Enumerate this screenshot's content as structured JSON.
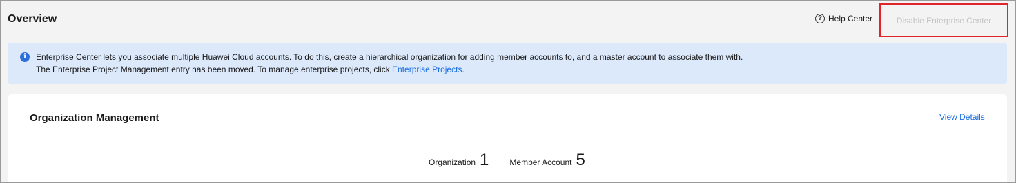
{
  "header": {
    "title": "Overview",
    "help_center": "Help Center",
    "help_icon": "question-circle-icon",
    "disable_button": "Disable Enterprise Center"
  },
  "banner": {
    "icon": "info-circle-icon",
    "line1": "Enterprise Center lets you associate multiple Huawei Cloud accounts. To do this, create a hierarchical organization for adding member accounts to, and a master account to associate them with.",
    "line2_prefix": "The Enterprise Project Management entry has been moved. To manage enterprise projects, click ",
    "line2_link": "Enterprise Projects",
    "line2_suffix": "."
  },
  "org_card": {
    "title": "Organization Management",
    "view_details": "View Details",
    "stats": [
      {
        "label": "Organization",
        "value": "1"
      },
      {
        "label": "Member Account",
        "value": "5"
      }
    ]
  },
  "colors": {
    "link": "#1a6ee0",
    "banner_bg": "#dbe9fb",
    "info_icon": "#2a6fdb",
    "highlight_border": "#e0242b",
    "disabled_text": "#c3c3c3"
  }
}
